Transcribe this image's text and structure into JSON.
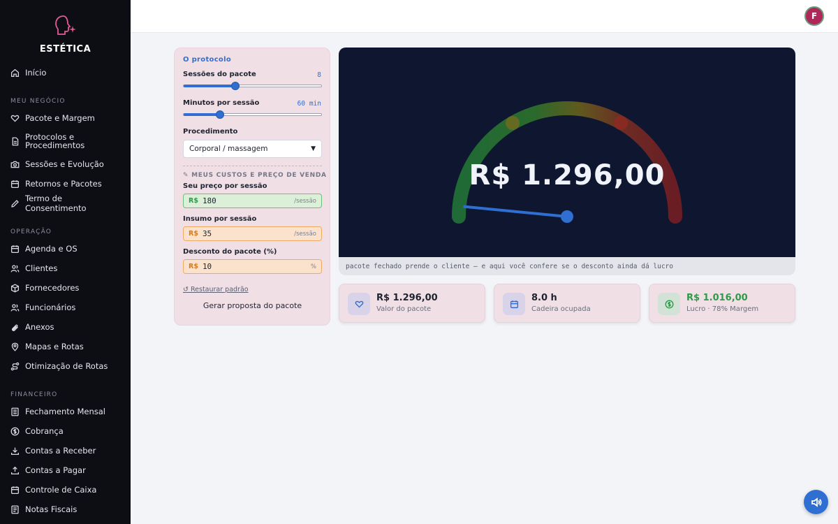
{
  "brand": {
    "name": "ESTÉTICA",
    "icon": "head-sparkle-logo"
  },
  "sidebar": {
    "home": {
      "label": "Início",
      "icon": "home-icon"
    },
    "sections": [
      {
        "title": "MEU NEGÓCIO",
        "items": [
          {
            "label": "Pacote e Margem",
            "icon": "heart-icon"
          },
          {
            "label": "Protocolos e Procedimentos",
            "icon": "document-icon"
          },
          {
            "label": "Sessões e Evolução",
            "icon": "camera-icon"
          },
          {
            "label": "Retornos e Pacotes",
            "icon": "calendar-icon"
          },
          {
            "label": "Termo de Consentimento",
            "icon": "pen-icon"
          }
        ]
      },
      {
        "title": "OPERAÇÃO",
        "items": [
          {
            "label": "Agenda e OS",
            "icon": "calendar-icon"
          },
          {
            "label": "Clientes",
            "icon": "users-icon"
          },
          {
            "label": "Fornecedores",
            "icon": "box-icon"
          },
          {
            "label": "Funcionários",
            "icon": "users-icon"
          },
          {
            "label": "Anexos",
            "icon": "paperclip-icon"
          },
          {
            "label": "Mapas e Rotas",
            "icon": "map-pin-icon"
          },
          {
            "label": "Otimização de Rotas",
            "icon": "route-icon"
          }
        ]
      },
      {
        "title": "FINANCEIRO",
        "items": [
          {
            "label": "Fechamento Mensal",
            "icon": "document-icon"
          },
          {
            "label": "Cobrança",
            "icon": "dollar-icon"
          },
          {
            "label": "Contas a Receber",
            "icon": "download-icon"
          },
          {
            "label": "Contas a Pagar",
            "icon": "upload-icon"
          },
          {
            "label": "Controle de Caixa",
            "icon": "calendar-icon"
          },
          {
            "label": "Notas Fiscais",
            "icon": "document-icon"
          }
        ]
      }
    ]
  },
  "user": {
    "initial": "F"
  },
  "protocol": {
    "title": "O protocolo",
    "sessions": {
      "label": "Sessões do pacote",
      "value_text": "8",
      "fraction": 0.37
    },
    "minutes": {
      "label": "Minutos por sessão",
      "value_text": "60 min",
      "fraction": 0.26
    },
    "procedure": {
      "label": "Procedimento",
      "selected": "Corporal / massagem"
    },
    "costs_caption": "✎ MEUS CUSTOS E PREÇO DE VENDA",
    "price": {
      "label": "Seu preço por sessão",
      "currency": "R$",
      "value": "180",
      "unit": "/sessão"
    },
    "supply": {
      "label": "Insumo por sessão",
      "currency": "R$",
      "value": "35",
      "unit": "/sessão"
    },
    "discount": {
      "label": "Desconto do pacote (%)",
      "currency": "R$",
      "value": "10",
      "unit": "%"
    },
    "restore_label": "↺ Restaurar padrão",
    "generate_label": "Gerar proposta do pacote"
  },
  "gauge": {
    "value_text": "R$ 1.296,00",
    "needle_fraction": 0.21,
    "caption": "pacote fechado prende o cliente — e aqui você confere se o desconto ainda dá lucro",
    "colors": {
      "green": "#1f7a3a",
      "olive": "#6b6a22",
      "red": "#7a1e24",
      "needle": "#2f6fd1"
    }
  },
  "stats": [
    {
      "value": "R$ 1.296,00",
      "label": "Valor do pacote",
      "icon": "heart-icon",
      "color": "#1f2330",
      "icon_bg": "#d9d3ea",
      "icon_color": "#2f6fd1"
    },
    {
      "value": "8.0 h",
      "label": "Cadeira ocupada",
      "icon": "calendar-icon",
      "color": "#1f2330",
      "icon_bg": "#d9d3ea",
      "icon_color": "#2f6fd1"
    },
    {
      "value": "R$ 1.016,00",
      "label": "Lucro · 78% Margem",
      "icon": "dollar-icon",
      "color": "#2e9a48",
      "icon_bg": "#d3e2d6",
      "icon_color": "#2e9a48"
    }
  ],
  "fab_icon": "speaker-icon"
}
